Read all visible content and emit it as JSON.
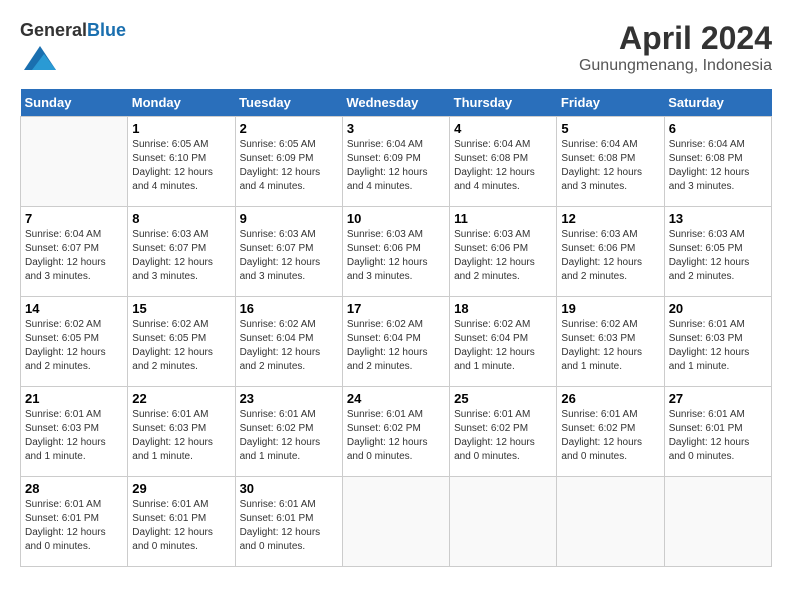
{
  "logo": {
    "general": "General",
    "blue": "Blue"
  },
  "title": "April 2024",
  "subtitle": "Gunungmenang, Indonesia",
  "days_header": [
    "Sunday",
    "Monday",
    "Tuesday",
    "Wednesday",
    "Thursday",
    "Friday",
    "Saturday"
  ],
  "weeks": [
    [
      {
        "day": "",
        "info": ""
      },
      {
        "day": "1",
        "info": "Sunrise: 6:05 AM\nSunset: 6:10 PM\nDaylight: 12 hours\nand 4 minutes."
      },
      {
        "day": "2",
        "info": "Sunrise: 6:05 AM\nSunset: 6:09 PM\nDaylight: 12 hours\nand 4 minutes."
      },
      {
        "day": "3",
        "info": "Sunrise: 6:04 AM\nSunset: 6:09 PM\nDaylight: 12 hours\nand 4 minutes."
      },
      {
        "day": "4",
        "info": "Sunrise: 6:04 AM\nSunset: 6:08 PM\nDaylight: 12 hours\nand 4 minutes."
      },
      {
        "day": "5",
        "info": "Sunrise: 6:04 AM\nSunset: 6:08 PM\nDaylight: 12 hours\nand 3 minutes."
      },
      {
        "day": "6",
        "info": "Sunrise: 6:04 AM\nSunset: 6:08 PM\nDaylight: 12 hours\nand 3 minutes."
      }
    ],
    [
      {
        "day": "7",
        "info": "Sunrise: 6:04 AM\nSunset: 6:07 PM\nDaylight: 12 hours\nand 3 minutes."
      },
      {
        "day": "8",
        "info": "Sunrise: 6:03 AM\nSunset: 6:07 PM\nDaylight: 12 hours\nand 3 minutes."
      },
      {
        "day": "9",
        "info": "Sunrise: 6:03 AM\nSunset: 6:07 PM\nDaylight: 12 hours\nand 3 minutes."
      },
      {
        "day": "10",
        "info": "Sunrise: 6:03 AM\nSunset: 6:06 PM\nDaylight: 12 hours\nand 3 minutes."
      },
      {
        "day": "11",
        "info": "Sunrise: 6:03 AM\nSunset: 6:06 PM\nDaylight: 12 hours\nand 2 minutes."
      },
      {
        "day": "12",
        "info": "Sunrise: 6:03 AM\nSunset: 6:06 PM\nDaylight: 12 hours\nand 2 minutes."
      },
      {
        "day": "13",
        "info": "Sunrise: 6:03 AM\nSunset: 6:05 PM\nDaylight: 12 hours\nand 2 minutes."
      }
    ],
    [
      {
        "day": "14",
        "info": "Sunrise: 6:02 AM\nSunset: 6:05 PM\nDaylight: 12 hours\nand 2 minutes."
      },
      {
        "day": "15",
        "info": "Sunrise: 6:02 AM\nSunset: 6:05 PM\nDaylight: 12 hours\nand 2 minutes."
      },
      {
        "day": "16",
        "info": "Sunrise: 6:02 AM\nSunset: 6:04 PM\nDaylight: 12 hours\nand 2 minutes."
      },
      {
        "day": "17",
        "info": "Sunrise: 6:02 AM\nSunset: 6:04 PM\nDaylight: 12 hours\nand 2 minutes."
      },
      {
        "day": "18",
        "info": "Sunrise: 6:02 AM\nSunset: 6:04 PM\nDaylight: 12 hours\nand 1 minute."
      },
      {
        "day": "19",
        "info": "Sunrise: 6:02 AM\nSunset: 6:03 PM\nDaylight: 12 hours\nand 1 minute."
      },
      {
        "day": "20",
        "info": "Sunrise: 6:01 AM\nSunset: 6:03 PM\nDaylight: 12 hours\nand 1 minute."
      }
    ],
    [
      {
        "day": "21",
        "info": "Sunrise: 6:01 AM\nSunset: 6:03 PM\nDaylight: 12 hours\nand 1 minute."
      },
      {
        "day": "22",
        "info": "Sunrise: 6:01 AM\nSunset: 6:03 PM\nDaylight: 12 hours\nand 1 minute."
      },
      {
        "day": "23",
        "info": "Sunrise: 6:01 AM\nSunset: 6:02 PM\nDaylight: 12 hours\nand 1 minute."
      },
      {
        "day": "24",
        "info": "Sunrise: 6:01 AM\nSunset: 6:02 PM\nDaylight: 12 hours\nand 0 minutes."
      },
      {
        "day": "25",
        "info": "Sunrise: 6:01 AM\nSunset: 6:02 PM\nDaylight: 12 hours\nand 0 minutes."
      },
      {
        "day": "26",
        "info": "Sunrise: 6:01 AM\nSunset: 6:02 PM\nDaylight: 12 hours\nand 0 minutes."
      },
      {
        "day": "27",
        "info": "Sunrise: 6:01 AM\nSunset: 6:01 PM\nDaylight: 12 hours\nand 0 minutes."
      }
    ],
    [
      {
        "day": "28",
        "info": "Sunrise: 6:01 AM\nSunset: 6:01 PM\nDaylight: 12 hours\nand 0 minutes."
      },
      {
        "day": "29",
        "info": "Sunrise: 6:01 AM\nSunset: 6:01 PM\nDaylight: 12 hours\nand 0 minutes."
      },
      {
        "day": "30",
        "info": "Sunrise: 6:01 AM\nSunset: 6:01 PM\nDaylight: 12 hours\nand 0 minutes."
      },
      {
        "day": "",
        "info": ""
      },
      {
        "day": "",
        "info": ""
      },
      {
        "day": "",
        "info": ""
      },
      {
        "day": "",
        "info": ""
      }
    ]
  ]
}
